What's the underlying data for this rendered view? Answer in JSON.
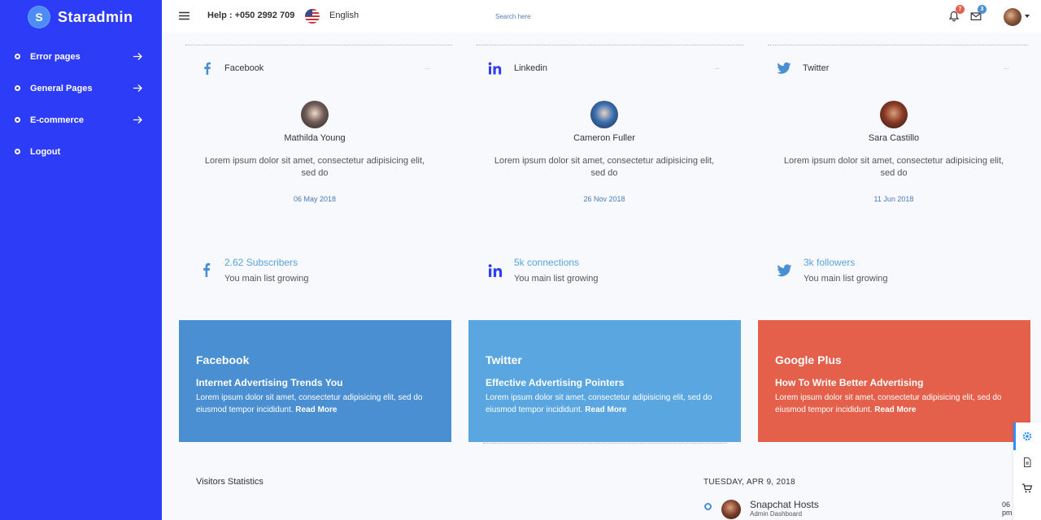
{
  "brand": {
    "logo_letter": "S",
    "name": "Staradmin"
  },
  "sidebar": {
    "items": [
      {
        "label": "Error pages",
        "has_arrow": true
      },
      {
        "label": "General Pages",
        "has_arrow": true
      },
      {
        "label": "E-commerce",
        "has_arrow": true
      },
      {
        "label": "Logout",
        "has_arrow": false
      }
    ]
  },
  "topbar": {
    "help": "Help : +050 2992 709",
    "language": "English",
    "search_placeholder": "Search here",
    "notifications_count": "7",
    "messages_count": "3"
  },
  "social": [
    {
      "network": "Facebook",
      "icon": "facebook-icon",
      "person": "Mathilda Young",
      "text": "Lorem ipsum dolor sit amet, consectetur adipisicing elit, sed do",
      "date": "06 May 2018",
      "stat_value": "2.62 Subscribers",
      "stat_sub": "You main list growing"
    },
    {
      "network": "Linkedin",
      "icon": "linkedin-icon",
      "person": "Cameron Fuller",
      "text": "Lorem ipsum dolor sit amet, consectetur adipisicing elit, sed do",
      "date": "26 Nov 2018",
      "stat_value": "5k connections",
      "stat_sub": "You main list growing"
    },
    {
      "network": "Twitter",
      "icon": "twitter-icon",
      "person": "Sara Castillo",
      "text": "Lorem ipsum dolor sit amet, consectetur adipisicing elit, sed do",
      "date": "11 Jun 2018",
      "stat_value": "3k followers",
      "stat_sub": "You main list growing"
    }
  ],
  "cards": [
    {
      "title": "Facebook",
      "subtitle": "Internet Advertising Trends You",
      "text": "Lorem ipsum dolor sit amet, consectetur adipisicing elit, sed do eiusmod tempor incididunt.",
      "link": "Read More",
      "color": "#4a8fd1"
    },
    {
      "title": "Twitter",
      "subtitle": "Effective Advertising Pointers",
      "text": "Lorem ipsum dolor sit amet, consectetur adipisicing elit, sed do eiusmod tempor incididunt.",
      "link": "Read More",
      "color": "#5aa6e0"
    },
    {
      "title": "Google Plus",
      "subtitle": "How To Write Better Advertising",
      "text": "Lorem ipsum dolor sit amet, consectetur adipisicing elit, sed do eiusmod tempor incididunt.",
      "link": "Read More",
      "color": "#e4604a"
    }
  ],
  "visitors": {
    "title": "Visitors Statistics"
  },
  "timeline": {
    "date": "TUESDAY, APR 9, 2018",
    "items": [
      {
        "title": "Snapchat Hosts",
        "subtitle": "Admin Dashboard",
        "time": "06 pm"
      }
    ]
  },
  "colors": {
    "sidebar": "#2d3cf6",
    "accent": "#5aa3d9"
  }
}
